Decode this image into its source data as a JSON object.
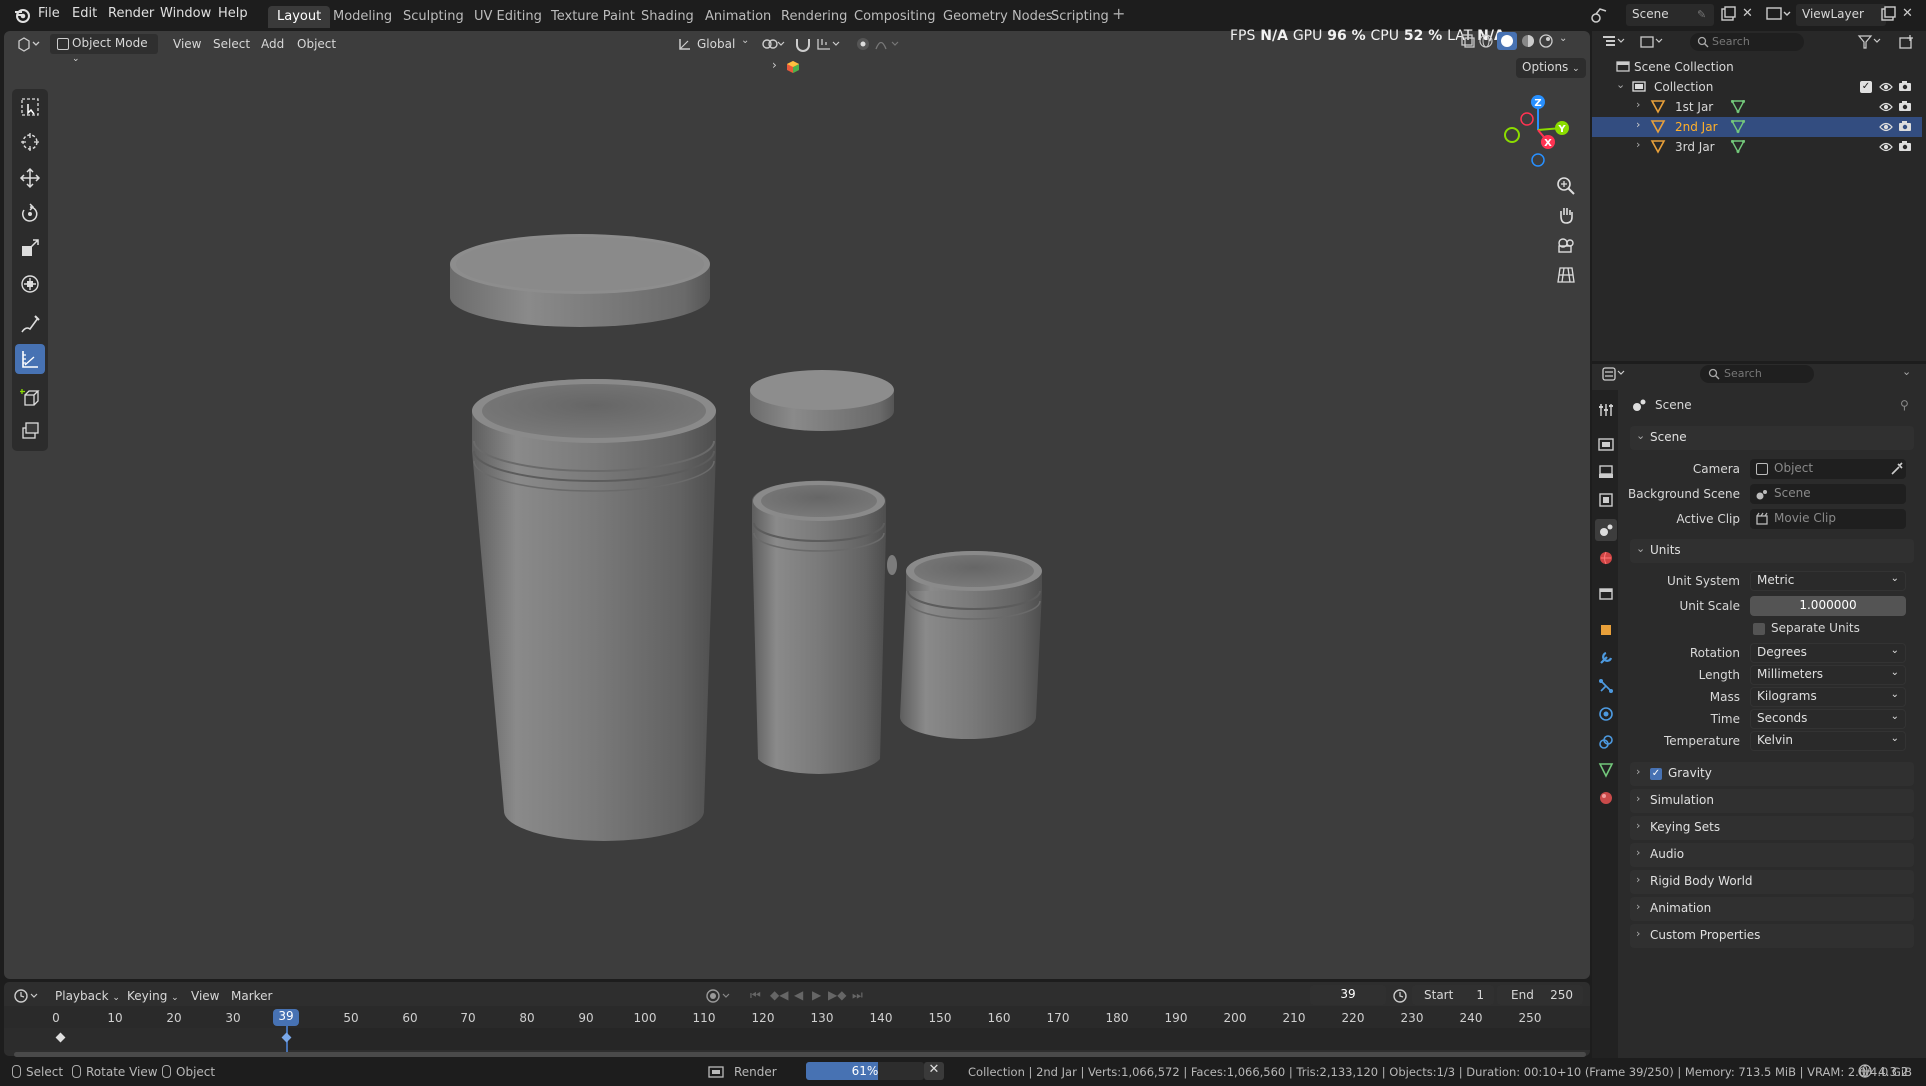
{
  "menu": {
    "file": "File",
    "edit": "Edit",
    "render": "Render",
    "window": "Window",
    "help": "Help"
  },
  "workspaces": [
    "Layout",
    "Modeling",
    "Sculpting",
    "UV Editing",
    "Texture Paint",
    "Shading",
    "Animation",
    "Rendering",
    "Compositing",
    "Geometry Nodes",
    "Scripting"
  ],
  "top_right": {
    "scene": "Scene",
    "view_layer": "ViewLayer"
  },
  "viewport_header": {
    "mode": "Object Mode",
    "view": "View",
    "select": "Select",
    "add": "Add",
    "object": "Object",
    "orientation": "Global",
    "options": "Options"
  },
  "overlay_stats": {
    "fps_label": "FPS",
    "fps": "N/A",
    "gpu_label": "GPU",
    "gpu": "96 %",
    "cpu_label": "CPU",
    "cpu": "52 %",
    "lat_label": "LAT",
    "lat": "N/A"
  },
  "nav_gizmo": {
    "z": "Z",
    "y": "Y",
    "x": "X"
  },
  "outliner": {
    "search_placeholder": "Search",
    "scene_collection": "Scene Collection",
    "collection": "Collection",
    "objects": [
      {
        "name": "1st Jar",
        "selected": false
      },
      {
        "name": "2nd Jar",
        "selected": true
      },
      {
        "name": "3rd Jar",
        "selected": false
      }
    ]
  },
  "properties": {
    "search_placeholder": "Search",
    "context": "Scene",
    "scene_panel": "Scene",
    "camera_label": "Camera",
    "camera_placeholder": "Object",
    "bg_label": "Background Scene",
    "bg_placeholder": "Scene",
    "clip_label": "Active Clip",
    "clip_placeholder": "Movie Clip",
    "units_panel": "Units",
    "unit_system_label": "Unit System",
    "unit_system": "Metric",
    "unit_scale_label": "Unit Scale",
    "unit_scale": "1.000000",
    "separate_units": "Separate Units",
    "rotation_label": "Rotation",
    "rotation": "Degrees",
    "length_label": "Length",
    "length": "Millimeters",
    "mass_label": "Mass",
    "mass": "Kilograms",
    "time_label": "Time",
    "time": "Seconds",
    "temperature_label": "Temperature",
    "temperature": "Kelvin",
    "gravity": "Gravity",
    "collapsed": [
      "Simulation",
      "Keying Sets",
      "Audio",
      "Rigid Body World",
      "Animation",
      "Custom Properties"
    ]
  },
  "timeline": {
    "playback": "Playback",
    "keying": "Keying",
    "view": "View",
    "marker": "Marker",
    "current_frame": "39",
    "start_label": "Start",
    "start": "1",
    "end_label": "End",
    "end": "250",
    "ticks": [
      "0",
      "10",
      "20",
      "30",
      "50",
      "60",
      "70",
      "80",
      "90",
      "100",
      "110",
      "120",
      "130",
      "140",
      "150",
      "160",
      "170",
      "180",
      "190",
      "200",
      "210",
      "220",
      "230",
      "240",
      "250"
    ]
  },
  "status": {
    "select": "Select",
    "rotate": "Rotate View",
    "object": "Object",
    "render_label": "Render",
    "render_progress": "61%",
    "render_progress_fraction": 0.61,
    "info": "Collection | 2nd Jar | Verts:1,066,572 | Faces:1,066,560 | Tris:2,133,120 | Objects:1/3 | Duration: 00:10+10 (Frame 39/250) | Memory: 713.5 MiB | VRAM: 2.0/4.0 GiB",
    "version": "4.3.2"
  },
  "colors": {
    "accent": "#4772b3",
    "selected_row": "#334d80",
    "selected_text": "#ffaf29",
    "object_orange": "#e8a03a",
    "mesh_green": "#73c77b",
    "x_axis": "#ff3352",
    "y_axis": "#8bdc00",
    "z_axis": "#2890ff"
  }
}
